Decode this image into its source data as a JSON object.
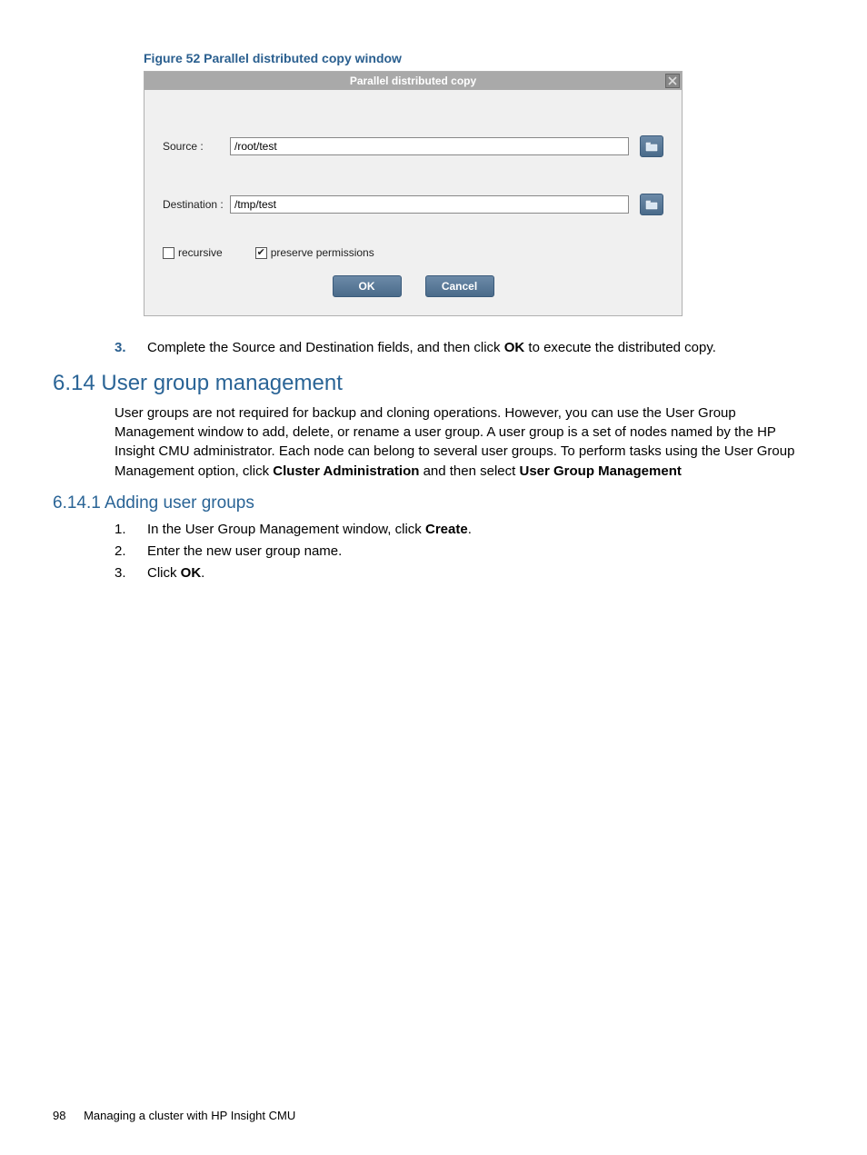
{
  "figure_caption": "Figure 52 Parallel distributed copy window",
  "dialog": {
    "title": "Parallel distributed copy",
    "source_label": "Source :",
    "source_value": "/root/test",
    "destination_label": "Destination :",
    "destination_value": "/tmp/test",
    "recursive_label": "recursive",
    "recursive_checked": false,
    "preserve_label": "preserve permissions",
    "preserve_checked": true,
    "ok_label": "OK",
    "cancel_label": "Cancel"
  },
  "step3": {
    "num": "3.",
    "pre": "Complete the Source and Destination fields, and then click ",
    "bold": "OK",
    "post": " to execute the distributed copy."
  },
  "section": {
    "title": "6.14 User group management",
    "para_pre": "User groups are not required for backup and cloning operations. However, you can use the User Group Management window to add, delete, or rename a user group. A user group is a set of nodes named by the HP Insight CMU administrator. Each node can belong to several user groups. To perform tasks using the User Group Management option, click ",
    "para_bold1": "Cluster Administration",
    "para_mid": " and then select ",
    "para_bold2": "User Group Management"
  },
  "subsection": {
    "title": "6.14.1 Adding user groups",
    "items": [
      {
        "num": "1.",
        "pre": "In the User Group Management window, click ",
        "bold": "Create",
        "post": "."
      },
      {
        "num": "2.",
        "pre": "Enter the new user group name.",
        "bold": "",
        "post": ""
      },
      {
        "num": "3.",
        "pre": "Click ",
        "bold": "OK",
        "post": "."
      }
    ]
  },
  "footer": {
    "page": "98",
    "title": "Managing a cluster with HP Insight CMU"
  }
}
